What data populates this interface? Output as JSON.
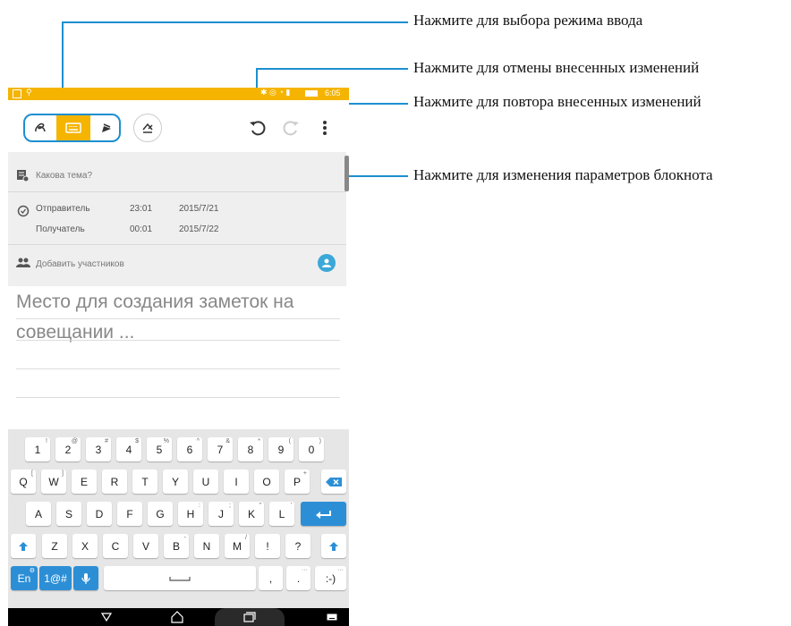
{
  "callouts": {
    "input_mode": "Нажмите для выбора режима ввода",
    "undo": "Нажмите для отмены внесенных изменений",
    "redo": "Нажмите для повтора внесенных изменений",
    "settings": "Нажмите для изменения параметров блокнота"
  },
  "status_bar": {
    "time": "6:05"
  },
  "toolbar": {
    "icons": [
      "handwriting-icon",
      "keyboard-icon",
      "pen-icon",
      "draw-icon",
      "undo-icon",
      "redo-icon",
      "more-icon"
    ]
  },
  "meeting": {
    "topic_placeholder": "Какова тема?",
    "sender_label": "Отправитель",
    "sender_time": "23:01",
    "sender_date": "2015/7/21",
    "recipient_label": "Получатель",
    "recipient_time": "00:01",
    "recipient_date": "2015/7/22",
    "add_participants": "Добавить участников"
  },
  "notes": {
    "line1": "Место для создания заметок на",
    "line2": "совещании ..."
  },
  "keyboard": {
    "row1": [
      {
        "k": "1",
        "s": "!"
      },
      {
        "k": "2",
        "s": "@"
      },
      {
        "k": "3",
        "s": "#"
      },
      {
        "k": "4",
        "s": "$"
      },
      {
        "k": "5",
        "s": "%"
      },
      {
        "k": "6",
        "s": "^"
      },
      {
        "k": "7",
        "s": "&"
      },
      {
        "k": "8",
        "s": "*"
      },
      {
        "k": "9",
        "s": "("
      },
      {
        "k": "0",
        "s": ")"
      }
    ],
    "row2": [
      {
        "k": "Q",
        "s": "["
      },
      {
        "k": "W",
        "s": "]"
      },
      {
        "k": "E",
        "s": ""
      },
      {
        "k": "R",
        "s": ""
      },
      {
        "k": "T",
        "s": ""
      },
      {
        "k": "Y",
        "s": ""
      },
      {
        "k": "U",
        "s": ""
      },
      {
        "k": "I",
        "s": ""
      },
      {
        "k": "O",
        "s": ""
      },
      {
        "k": "P",
        "s": "+"
      }
    ],
    "row3": [
      {
        "k": "A",
        "s": ""
      },
      {
        "k": "S",
        "s": ""
      },
      {
        "k": "D",
        "s": ""
      },
      {
        "k": "F",
        "s": ""
      },
      {
        "k": "G",
        "s": ""
      },
      {
        "k": "H",
        "s": ":"
      },
      {
        "k": "J",
        "s": ";"
      },
      {
        "k": "K",
        "s": "\""
      },
      {
        "k": "L",
        "s": "'"
      }
    ],
    "row4": [
      {
        "k": "Z",
        "s": ""
      },
      {
        "k": "X",
        "s": ""
      },
      {
        "k": "C",
        "s": ""
      },
      {
        "k": "V",
        "s": ""
      },
      {
        "k": "B",
        "s": "-"
      },
      {
        "k": "N",
        "s": ""
      },
      {
        "k": "M",
        "s": "/"
      },
      {
        "k": "!",
        "s": ""
      },
      {
        "k": "?",
        "s": ""
      }
    ],
    "lang": "En",
    "symbols": "1@#",
    "comma": ",",
    "period": ".",
    "emoticon": ":-)"
  }
}
